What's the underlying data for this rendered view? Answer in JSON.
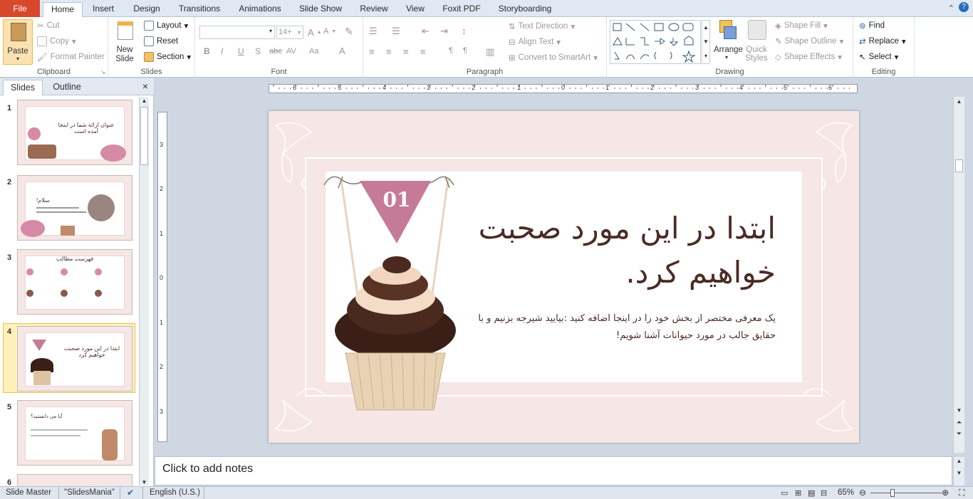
{
  "tabs": {
    "file": "File",
    "home": "Home",
    "insert": "Insert",
    "design": "Design",
    "transitions": "Transitions",
    "animations": "Animations",
    "slideshow": "Slide Show",
    "review": "Review",
    "view": "View",
    "foxit": "Foxit PDF",
    "storyboarding": "Storyboarding"
  },
  "clipboard": {
    "paste": "Paste",
    "cut": "Cut",
    "copy": "Copy",
    "format_painter": "Format Painter",
    "label": "Clipboard"
  },
  "slides_group": {
    "new_slide": "New",
    "new_slide2": "Slide",
    "layout": "Layout",
    "reset": "Reset",
    "section": "Section",
    "label": "Slides"
  },
  "font": {
    "name": "",
    "size": "14+",
    "label": "Font",
    "bold": "B",
    "italic": "I",
    "underline": "U",
    "shadow": "S",
    "strike": "abc",
    "spacing": "AV",
    "case": "Aa",
    "color": "A"
  },
  "paragraph": {
    "text_direction": "Text Direction",
    "align_text": "Align Text",
    "smartart": "Convert to SmartArt",
    "label": "Paragraph"
  },
  "drawing": {
    "arrange": "Arrange",
    "quick": "Quick",
    "styles": "Styles",
    "shape_fill": "Shape Fill",
    "shape_outline": "Shape Outline",
    "shape_effects": "Shape Effects",
    "label": "Drawing"
  },
  "editing": {
    "find": "Find",
    "replace": "Replace",
    "select": "Select",
    "label": "Editing"
  },
  "panel": {
    "slides_tab": "Slides",
    "outline_tab": "Outline",
    "close": "×"
  },
  "thumbs": [
    {
      "num": "1",
      "title": "عنوان ارائه شما در اینجا آمده است"
    },
    {
      "num": "2",
      "title": "!سلام"
    },
    {
      "num": "3",
      "title": "فهرست مطالب"
    },
    {
      "num": "4",
      "title": "ابتدا در این مورد صحبت خواهیم کرد"
    },
    {
      "num": "5",
      "title": "آیا می دانستید؟"
    },
    {
      "num": "6",
      "title": ""
    }
  ],
  "slide": {
    "badge": "01",
    "title_line1": "ابتدا در این مورد صحبت",
    "title_line2": "خواهیم کرد.",
    "body_line1": "یک معرفی مختصر از بخش خود را در اینجا اضافه کنید :بیایید شیرجه بزنیم و با",
    "body_line2": "حقایق جالب در مورد حیوانات آشنا شویم!"
  },
  "ruler": {
    "h_ticks": [
      "6",
      "5",
      "4",
      "3",
      "2",
      "1",
      "0",
      "1",
      "2",
      "3",
      "4",
      "5",
      "6"
    ],
    "v_ticks": [
      "3",
      "2",
      "1",
      "0",
      "1",
      "2",
      "3"
    ]
  },
  "notes": {
    "placeholder": "Click to add notes"
  },
  "status": {
    "view": "Slide Master",
    "theme": "\"SlidesMania\"",
    "language": "English (U.S.)",
    "zoom": "65%"
  },
  "colors": {
    "accent": "#d8482b",
    "pink": "#f6e6e6",
    "title": "#4b2b25",
    "badge": "#c57b97"
  }
}
